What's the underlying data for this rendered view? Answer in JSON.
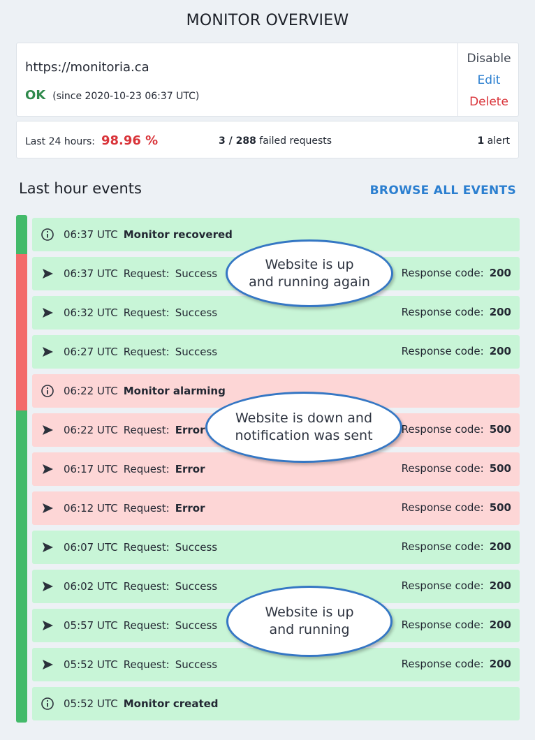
{
  "page": {
    "title": "MONITOR OVERVIEW"
  },
  "monitor": {
    "url": "https://monitoria.ca",
    "status": "OK",
    "since": "(since 2020-10-23 06:37 UTC)",
    "actions": {
      "disable": "Disable",
      "edit": "Edit",
      "delete": "Delete"
    }
  },
  "stats": {
    "uptime_label": "Last 24 hours:",
    "uptime_value": "98.96 %",
    "failed_count": "3 / 288",
    "failed_label": "failed requests",
    "alerts_count": "1",
    "alerts_label": "alert"
  },
  "events_section": {
    "title": "Last hour events",
    "browse_label": "BROWSE ALL EVENTS"
  },
  "events": [
    {
      "kind": "info",
      "color": "green",
      "time": "06:37 UTC",
      "title": "Monitor recovered"
    },
    {
      "kind": "request",
      "color": "green",
      "time": "06:37 UTC",
      "label": "Request:",
      "value": "Success",
      "code_label": "Response code:",
      "code": "200"
    },
    {
      "kind": "request",
      "color": "green",
      "time": "06:32 UTC",
      "label": "Request:",
      "value": "Success",
      "code_label": "Response code:",
      "code": "200"
    },
    {
      "kind": "request",
      "color": "green",
      "time": "06:27 UTC",
      "label": "Request:",
      "value": "Success",
      "code_label": "Response code:",
      "code": "200"
    },
    {
      "kind": "info",
      "color": "red",
      "time": "06:22 UTC",
      "title": "Monitor alarming"
    },
    {
      "kind": "request",
      "color": "red",
      "time": "06:22 UTC",
      "label": "Request:",
      "value": "Error",
      "code_label": "Response code:",
      "code": "500"
    },
    {
      "kind": "request",
      "color": "red",
      "time": "06:17 UTC",
      "label": "Request:",
      "value": "Error",
      "code_label": "Response code:",
      "code": "500"
    },
    {
      "kind": "request",
      "color": "red",
      "time": "06:12 UTC",
      "label": "Request:",
      "value": "Error",
      "code_label": "Response code:",
      "code": "500"
    },
    {
      "kind": "request",
      "color": "green",
      "time": "06:07 UTC",
      "label": "Request:",
      "value": "Success",
      "code_label": "Response code:",
      "code": "200"
    },
    {
      "kind": "request",
      "color": "green",
      "time": "06:02 UTC",
      "label": "Request:",
      "value": "Success",
      "code_label": "Response code:",
      "code": "200"
    },
    {
      "kind": "request",
      "color": "green",
      "time": "05:57 UTC",
      "label": "Request:",
      "value": "Success",
      "code_label": "Response code:",
      "code": "200"
    },
    {
      "kind": "request",
      "color": "green",
      "time": "05:52 UTC",
      "label": "Request:",
      "value": "Success",
      "code_label": "Response code:",
      "code": "200"
    },
    {
      "kind": "info",
      "color": "green",
      "time": "05:52 UTC",
      "title": "Monitor created"
    }
  ],
  "callouts": {
    "up_again": [
      "Website is up",
      "and running again"
    ],
    "down": [
      "Website is down and",
      "notification was sent"
    ],
    "up": [
      "Website is up",
      "and running"
    ]
  },
  "colors": {
    "ok": "#2f8a4c",
    "error": "#d9343a",
    "link": "#2b7fd0",
    "event_green": "#c8f5d7",
    "event_red": "#fdd6d6",
    "timeline_green": "#43ba6a",
    "timeline_red": "#f36a6a"
  }
}
